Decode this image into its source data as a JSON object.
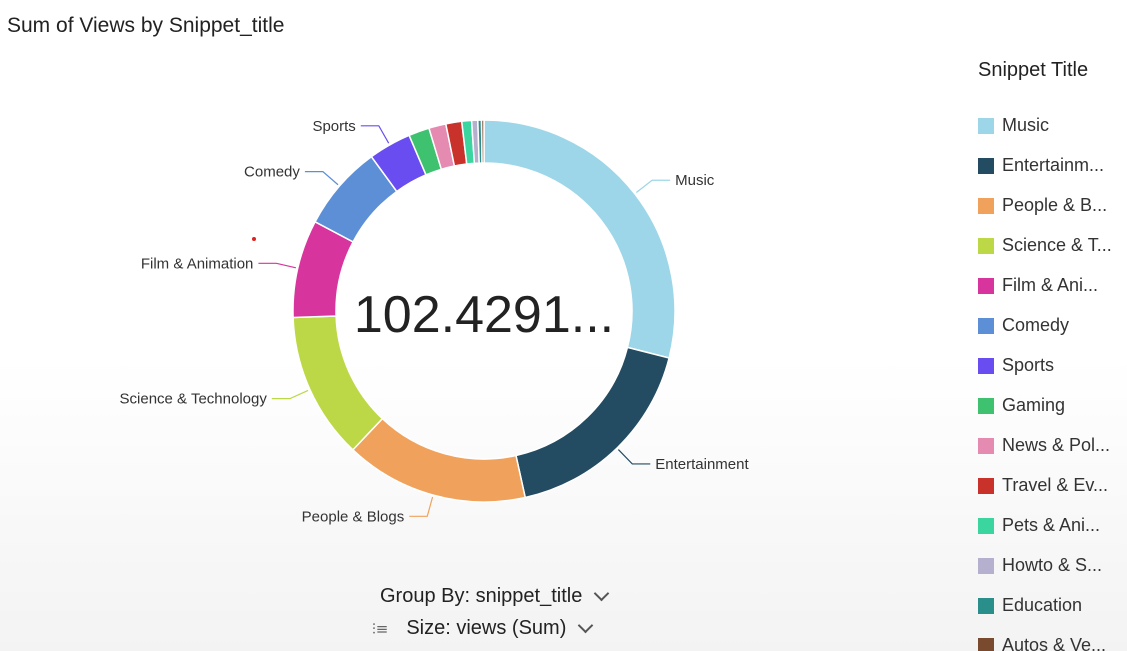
{
  "title": "Sum of Views by Snippet_title",
  "total_label": "102.4291...",
  "legend": {
    "title": "Snippet Title",
    "items": [
      {
        "label": "Music",
        "color": "#9dd6e8"
      },
      {
        "label": "Entertainm...",
        "color": "#234b61"
      },
      {
        "label": "People & B...",
        "color": "#f0a25c"
      },
      {
        "label": "Science & T...",
        "color": "#bcd846"
      },
      {
        "label": "Film & Ani...",
        "color": "#d8349d"
      },
      {
        "label": "Comedy",
        "color": "#5c8fd6"
      },
      {
        "label": "Sports",
        "color": "#6a4df0"
      },
      {
        "label": "Gaming",
        "color": "#3fc26f"
      },
      {
        "label": "News & Pol...",
        "color": "#e58bb1"
      },
      {
        "label": "Travel & Ev...",
        "color": "#c8322a"
      },
      {
        "label": "Pets & Ani...",
        "color": "#3bd6a0"
      },
      {
        "label": "Howto & S...",
        "color": "#b6b0cf"
      },
      {
        "label": "Education",
        "color": "#2a8f8a"
      },
      {
        "label": "Autos & Ve...",
        "color": "#7a4a2e"
      }
    ]
  },
  "controls": {
    "group_by": "Group By: snippet_title",
    "size": "Size: views (Sum)"
  },
  "chart_data": {
    "type": "pie",
    "title": "Sum of Views by Snippet_title",
    "donut": true,
    "center_label": "102.4291...",
    "legend_position": "right",
    "unit": "percent share (estimated)",
    "slices": [
      {
        "name": "Music",
        "value": 28.0,
        "color": "#9dd6e8",
        "label": "Music"
      },
      {
        "name": "Entertainment",
        "value": 17.0,
        "color": "#234b61",
        "label": "Entertainment"
      },
      {
        "name": "People & Blogs",
        "value": 15.0,
        "color": "#f0a25c",
        "label": "People & Blogs"
      },
      {
        "name": "Science & Technology",
        "value": 12.0,
        "color": "#bcd846",
        "label": "Science & Technology"
      },
      {
        "name": "Film & Animation",
        "value": 8.0,
        "color": "#d8349d",
        "label": "Film & Animation"
      },
      {
        "name": "Comedy",
        "value": 7.0,
        "color": "#5c8fd6",
        "label": "Comedy"
      },
      {
        "name": "Sports",
        "value": 3.5,
        "color": "#6a4df0",
        "label": "Sports"
      },
      {
        "name": "Gaming",
        "value": 1.7,
        "color": "#3fc26f",
        "label": ""
      },
      {
        "name": "News & Politics",
        "value": 1.4,
        "color": "#e58bb1",
        "label": ""
      },
      {
        "name": "Travel & Events",
        "value": 1.3,
        "color": "#c8322a",
        "label": ""
      },
      {
        "name": "Pets & Animals",
        "value": 0.8,
        "color": "#3bd6a0",
        "label": ""
      },
      {
        "name": "Howto & Style",
        "value": 0.5,
        "color": "#b6b0cf",
        "label": ""
      },
      {
        "name": "Education",
        "value": 0.3,
        "color": "#2a8f8a",
        "label": ""
      },
      {
        "name": "Autos & Vehicles",
        "value": 0.2,
        "color": "#7a4a2e",
        "label": ""
      }
    ]
  }
}
